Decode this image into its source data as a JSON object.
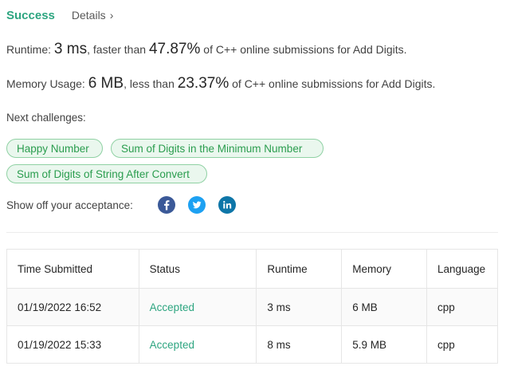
{
  "header": {
    "status": "Success",
    "details_label": "Details",
    "details_chevron": "›"
  },
  "runtime": {
    "label": "Runtime:",
    "value": "3 ms",
    "comparison": ", faster than",
    "percent": "47.87%",
    "suffix": "of C++ online submissions for Add Digits."
  },
  "memory": {
    "label": "Memory Usage:",
    "value": "6 MB",
    "comparison": ", less than",
    "percent": "23.37%",
    "suffix": "of C++ online submissions for Add Digits."
  },
  "next_challenges": {
    "label": "Next challenges:",
    "items": [
      "Happy Number",
      "Sum of Digits in the Minimum Number",
      "Sum of Digits of String After Convert"
    ]
  },
  "share": {
    "label": "Show off your acceptance:",
    "icons": [
      "facebook-icon",
      "twitter-icon",
      "linkedin-icon"
    ]
  },
  "submissions": {
    "headers": [
      "Time Submitted",
      "Status",
      "Runtime",
      "Memory",
      "Language"
    ],
    "rows": [
      {
        "time": "01/19/2022 16:52",
        "status": "Accepted",
        "runtime": "3 ms",
        "memory": "6 MB",
        "language": "cpp"
      },
      {
        "time": "01/19/2022 15:33",
        "status": "Accepted",
        "runtime": "8 ms",
        "memory": "5.9 MB",
        "language": "cpp"
      }
    ]
  },
  "colors": {
    "accent": "#2da580",
    "tag_border": "#8fd1a3",
    "tag_bg": "#eaf7ee",
    "facebook": "#3b5998",
    "twitter": "#1da1f2",
    "linkedin": "#0e76a8"
  }
}
